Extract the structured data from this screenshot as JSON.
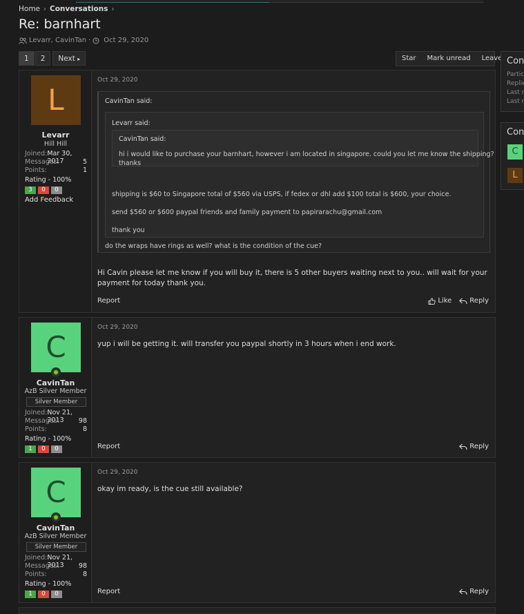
{
  "breadcrumb": {
    "home": "Home",
    "conversations": "Conversations"
  },
  "page": {
    "title": "Re: barnhart",
    "participants": "Levarr, CavinTan",
    "date": "Oct 29, 2020"
  },
  "pager": {
    "page1": "1",
    "page2": "2",
    "next": "Next"
  },
  "actions": {
    "star": "Star",
    "mark_unread": "Mark unread",
    "leave": "Leave"
  },
  "sidebar": {
    "info_title": "Conv",
    "info_lines": [
      "Partic",
      "Replie",
      "Last re",
      "Last re"
    ],
    "participants_title": "Conv",
    "avatars": [
      "C",
      "L"
    ]
  },
  "messages": [
    {
      "date": "Oct 29, 2020",
      "user": {
        "initial": "L",
        "name": "Levarr",
        "title": "Hill Hill",
        "joined_label": "Joined:",
        "joined": "Mar 30, 2017",
        "messages_label": "Messages:",
        "messages": "5",
        "points_label": "Points:",
        "points": "1",
        "rating": "Rating - 100%",
        "pos": "3",
        "neg": "0",
        "neu": "0",
        "add_feedback": "Add Feedback"
      },
      "quote_outer": {
        "author": "CavinTan said:",
        "quote_mid": {
          "author": "Levarr said:",
          "quote_inner": {
            "author": "CavinTan said:",
            "text_line1": "hi i would like to purchase your barnhart, however i am located in singapore. could you let me know the shipping?",
            "text_line2": "thanks"
          },
          "line1": "shipping is $60 to Singapore total of $560 via USPS, if fedex or dhl add $100 total is $600, your choice.",
          "line2": "send $560 or $600 paypal friends and family payment to papirarachu@gmail.com",
          "line3": "thank you"
        },
        "after": "do the wraps have rings as well? what is the condition of the cue?"
      },
      "body_line1": "Hi Cavin please let me know if you will buy it, there is 5 other buyers waiting next to you.. will wait for your",
      "body_line2": "payment for today thank you.",
      "report": "Report",
      "like": "Like",
      "reply": "Reply"
    },
    {
      "date": "Oct 29, 2020",
      "user": {
        "initial": "C",
        "name": "CavinTan",
        "title": "AzB Silver Member",
        "banner": "Silver Member",
        "joined_label": "Joined:",
        "joined": "Nov 21, 2013",
        "messages_label": "Messages:",
        "messages": "98",
        "points_label": "Points:",
        "points": "8",
        "rating": "Rating - 100%",
        "pos": "1",
        "neg": "0",
        "neu": "0"
      },
      "body_line1": "yup i will be getting it. will transfer you paypal shortly in 3 hours when i end work.",
      "report": "Report",
      "reply": "Reply"
    },
    {
      "date": "Oct 29, 2020",
      "user": {
        "initial": "C",
        "name": "CavinTan",
        "title": "AzB Silver Member",
        "banner": "Silver Member",
        "joined_label": "Joined:",
        "joined": "Nov 21, 2013",
        "messages_label": "Messages:",
        "messages": "98",
        "points_label": "Points:",
        "points": "8",
        "rating": "Rating - 100%",
        "pos": "1",
        "neg": "0",
        "neu": "0"
      },
      "body_line1": "okay im ready, is the cue still available?",
      "report": "Report",
      "reply": "Reply"
    }
  ],
  "colors": {
    "background": "#1c1c1c",
    "panel": "#222222",
    "avatar_levarr": "#5e3a13",
    "avatar_cavin": "#59d27e",
    "positive": "#4fa34d",
    "negative": "#d9473c",
    "neutral": "#8e8e8e"
  }
}
